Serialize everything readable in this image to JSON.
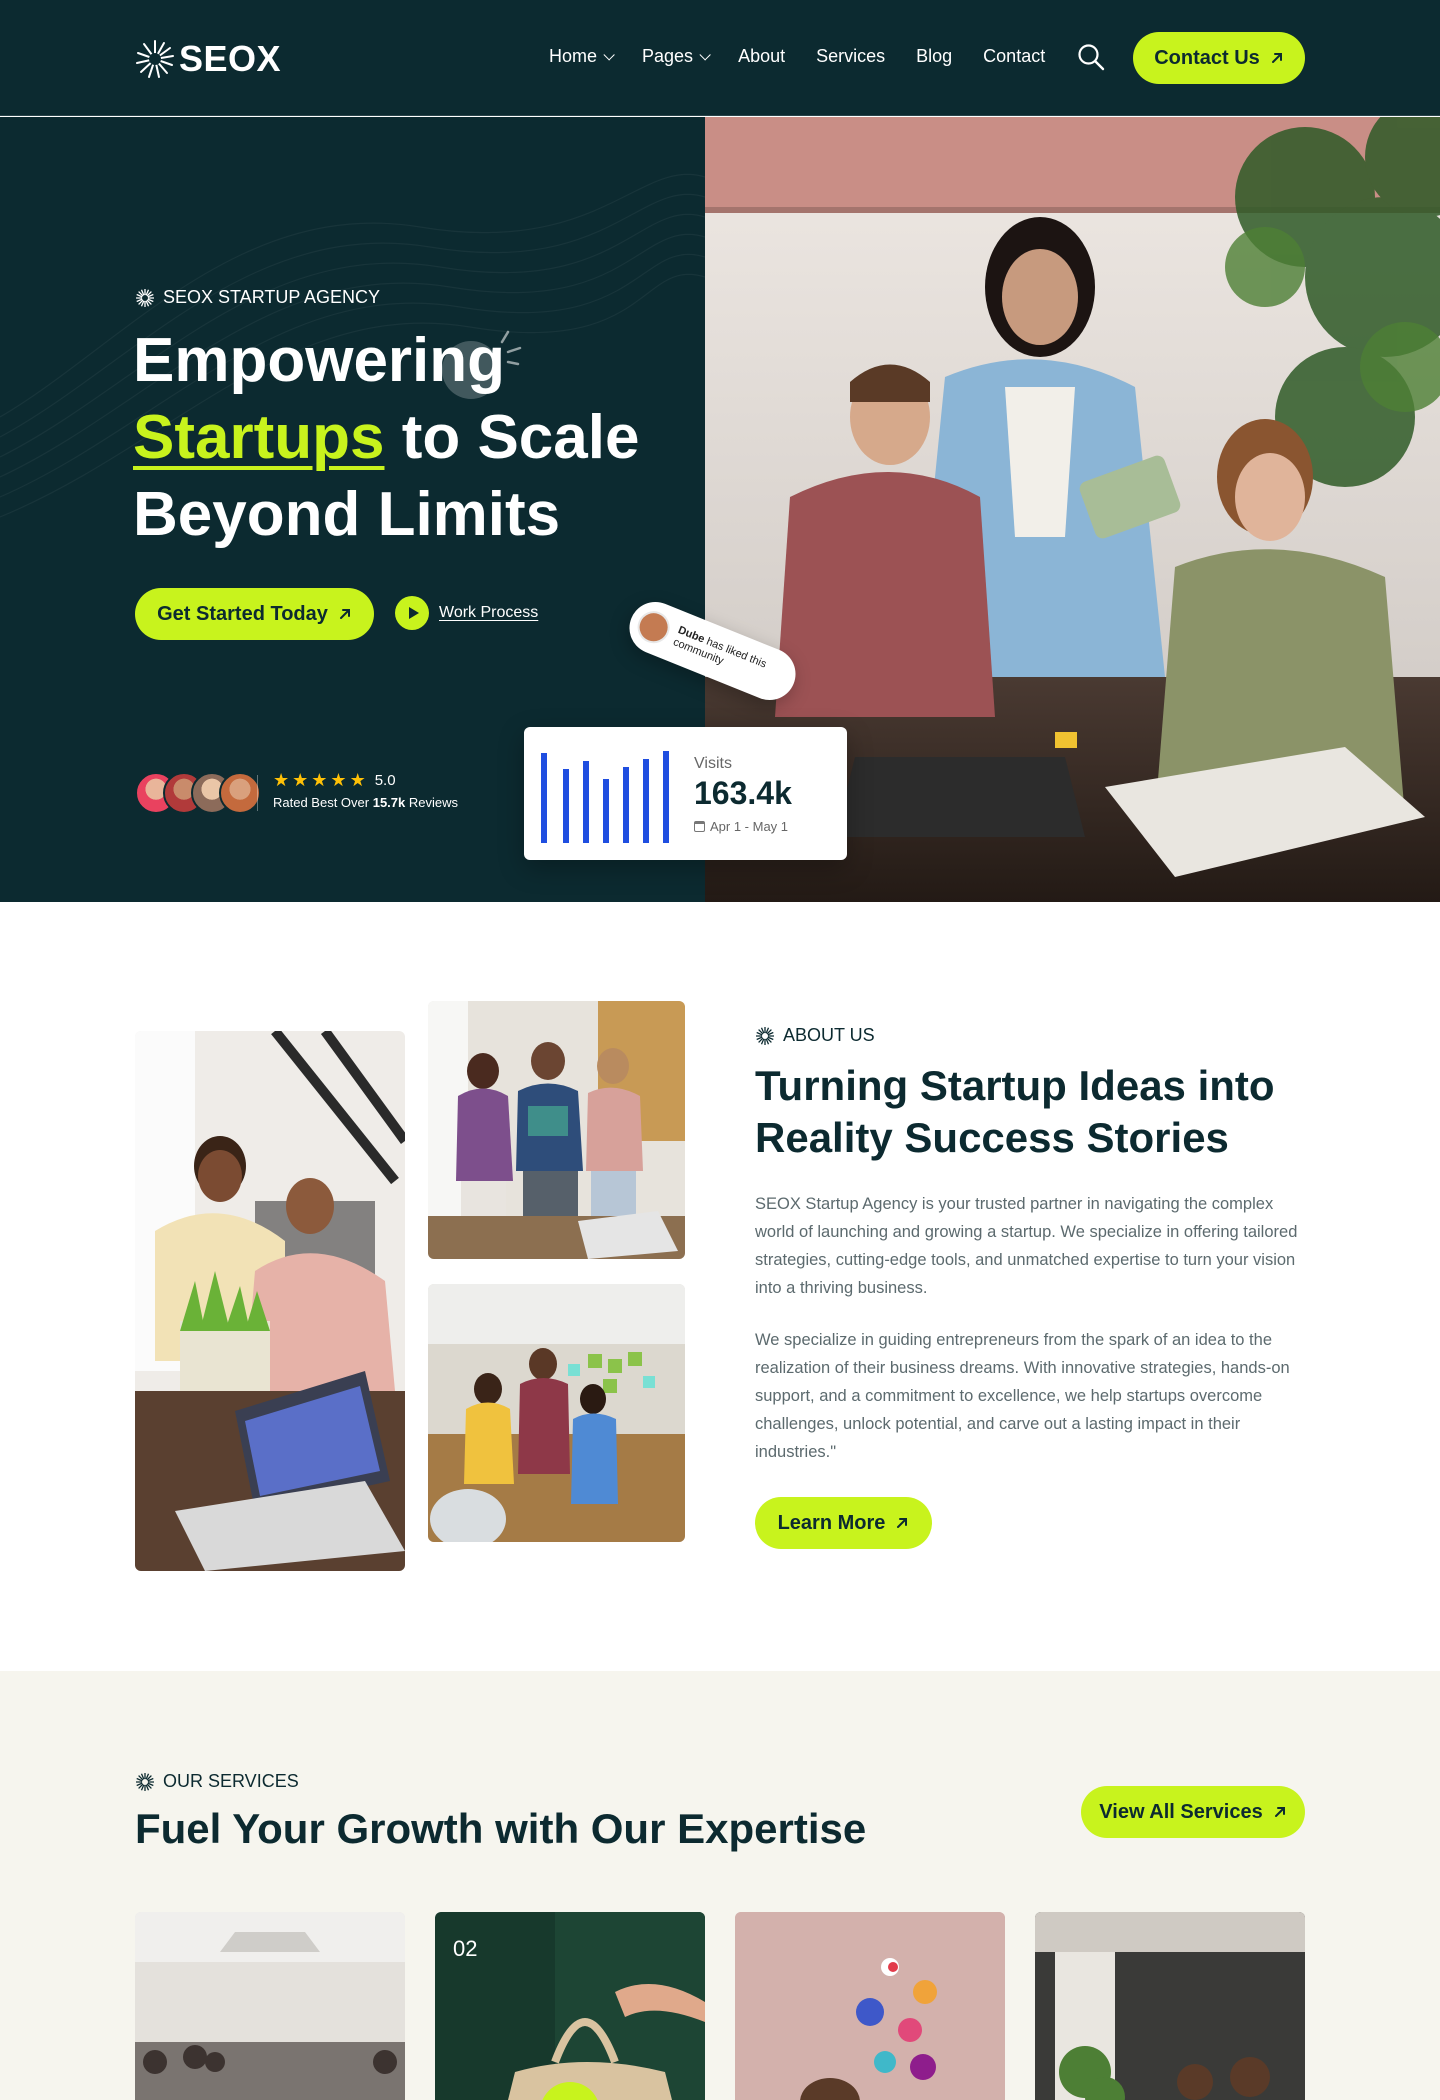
{
  "header": {
    "logo_text": "SEOX",
    "nav": [
      {
        "label": "Home",
        "has_dropdown": true
      },
      {
        "label": "Pages",
        "has_dropdown": true
      },
      {
        "label": "About",
        "has_dropdown": false
      },
      {
        "label": "Services",
        "has_dropdown": false
      },
      {
        "label": "Blog",
        "has_dropdown": false
      },
      {
        "label": "Contact",
        "has_dropdown": false
      }
    ],
    "contact_label": "Contact Us"
  },
  "hero": {
    "eyebrow": "SEOX STARTUP AGENCY",
    "title_line1": "Empowering",
    "title_highlight": "Startups",
    "title_line2_rest": " to Scale",
    "title_line3": "Beyond Limits",
    "cta_label": "Get Started Today",
    "work_process_label": "Work Process",
    "rating_score": "5.0",
    "rating_prefix": "Rated Best Over ",
    "rating_count": "15.7k",
    "rating_suffix": " Reviews",
    "like_name": "Dube",
    "like_text": " has liked this community",
    "visits_label": "Visits",
    "visits_value": "163.4k",
    "visits_range": "Apr 1 - May 1"
  },
  "about": {
    "eyebrow": "ABOUT US",
    "title": "Turning Startup Ideas into Reality Success Stories",
    "para1": "SEOX Startup Agency is your trusted partner in navigating the complex world of launching and growing a startup. We specialize in offering tailored strategies, cutting-edge tools, and unmatched expertise to turn your vision into a thriving business.",
    "para2": "We specialize in guiding entrepreneurs from the spark of an idea to the realization of their business dreams. With innovative strategies, hands-on support, and a commitment to excellence, we help startups overcome challenges, unlock potential, and carve out a lasting impact in their industries.\"",
    "learn_more_label": "Learn More"
  },
  "services": {
    "eyebrow": "OUR SERVICES",
    "title": "Fuel Your Growth with Our Expertise",
    "view_all_label": "View All Services",
    "card2_number": "02"
  },
  "colors": {
    "dark": "#0c2a30",
    "accent": "#c8f31d",
    "cream": "#f6f5ee",
    "chart_blue": "#1f4ee0"
  }
}
